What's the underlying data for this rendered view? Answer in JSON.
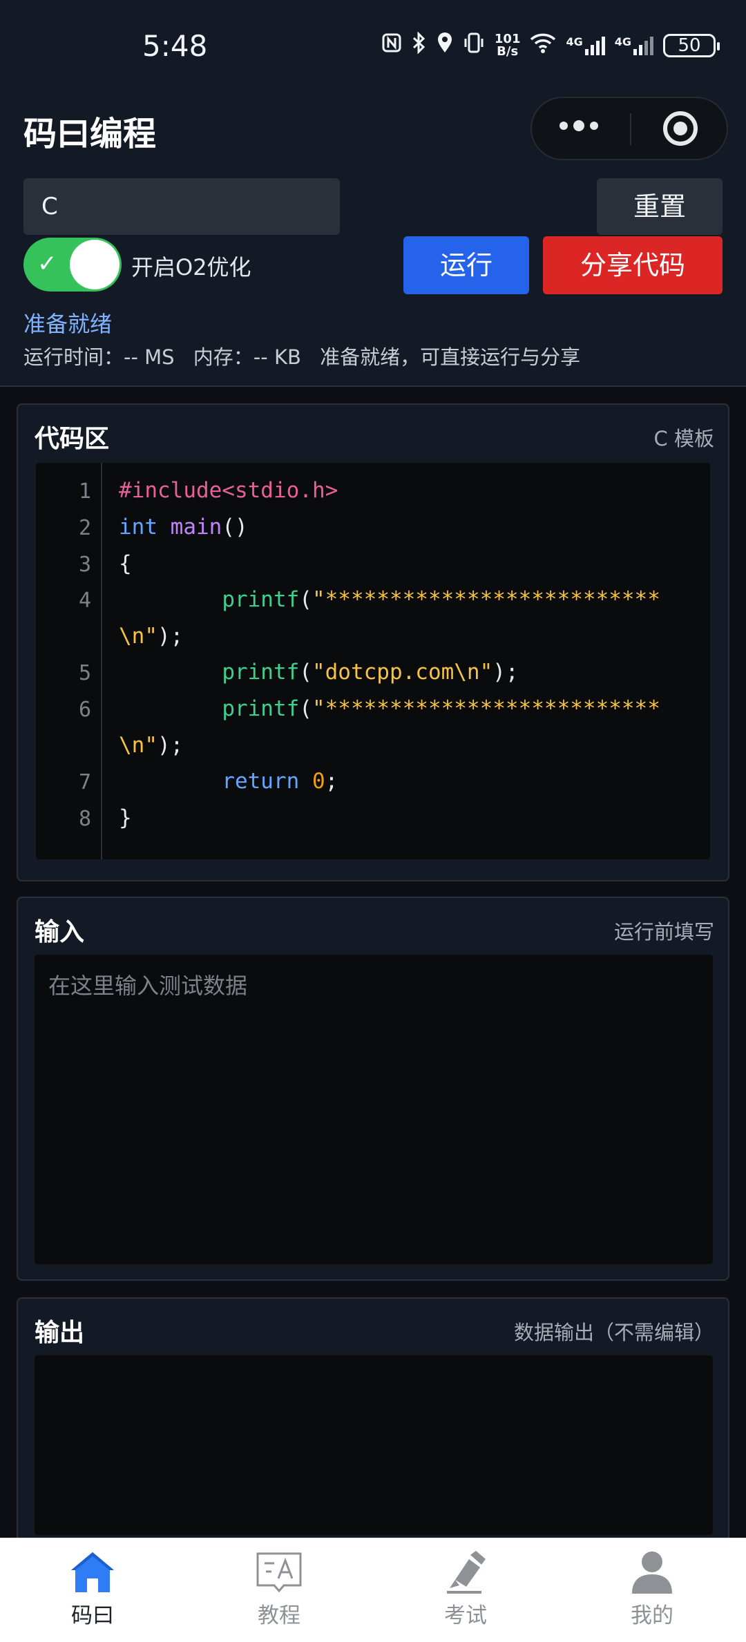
{
  "status_bar": {
    "time": "5:48",
    "net_speed_top": "101",
    "net_speed_bottom": "B/s",
    "signal_1": "4G",
    "signal_2": "4G",
    "battery": "50"
  },
  "header": {
    "title": "码曰编程"
  },
  "controls": {
    "language": "C",
    "reset_label": "重置",
    "o2_label": "开启O2优化",
    "o2_enabled": true,
    "run_label": "运行",
    "share_label": "分享代码"
  },
  "status": {
    "state": "准备就绪",
    "runtime": "运行时间：-- MS",
    "memory": "内存：-- KB",
    "message": "准备就绪，可直接运行与分享"
  },
  "code_panel": {
    "title": "代码区",
    "hint": "C 模板",
    "line_numbers": [
      "1",
      "2",
      "3",
      "4",
      "5",
      "6",
      "7",
      "8"
    ],
    "tokens": {
      "include": "#include<stdio.h>",
      "int_kw": "int",
      "main_fn": "main",
      "main_parens": "()",
      "open_brace": "{",
      "printf1": "printf",
      "printf1_open": "(",
      "printf1_str": "\"**************************",
      "printf1_str_cont": "\\n\"",
      "printf1_close": ");",
      "printf2": "printf",
      "printf2_open": "(",
      "printf2_str": "\"dotcpp.com\\n\"",
      "printf2_close": ");",
      "printf3": "printf",
      "printf3_open": "(",
      "printf3_str": "\"**************************",
      "printf3_str_cont": "\\n\"",
      "printf3_close": ");",
      "return_kw": "return",
      "return_val": "0",
      "return_semi": ";",
      "close_brace": "}"
    }
  },
  "input_panel": {
    "title": "输入",
    "hint": "运行前填写",
    "placeholder": "在这里输入测试数据"
  },
  "output_panel": {
    "title": "输出",
    "hint": "数据输出（不需编辑）"
  },
  "tabbar": {
    "items": [
      {
        "label": "码曰",
        "icon": "home-icon",
        "active": true
      },
      {
        "label": "教程",
        "icon": "tutorial-icon",
        "active": false
      },
      {
        "label": "考试",
        "icon": "exam-pen-icon",
        "active": false
      },
      {
        "label": "我的",
        "icon": "user-icon",
        "active": false
      }
    ]
  },
  "colors": {
    "run_button": "#2563eb",
    "share_button": "#dc2626",
    "toggle_on": "#35c25a",
    "status_ready": "#7fb2ff",
    "active_tab_icon": "#2f7df6"
  }
}
